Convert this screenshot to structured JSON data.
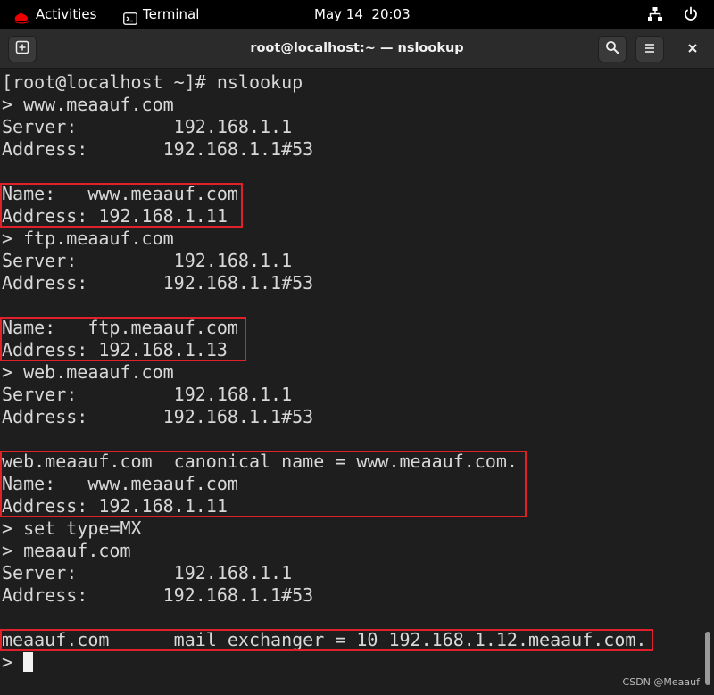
{
  "topbar": {
    "activities": "Activities",
    "app_name": "Terminal",
    "clock": "May 14  20:03"
  },
  "window": {
    "title": "root@localhost:~ — nslookup"
  },
  "terminal_lines": [
    "[root@localhost ~]# nslookup",
    "> www.meaauf.com",
    "Server:         192.168.1.1",
    "Address:       192.168.1.1#53",
    "",
    "Name:   www.meaauf.com",
    "Address: 192.168.1.11",
    "> ftp.meaauf.com",
    "Server:         192.168.1.1",
    "Address:       192.168.1.1#53",
    "",
    "Name:   ftp.meaauf.com",
    "Address: 192.168.1.13",
    "> web.meaauf.com",
    "Server:         192.168.1.1",
    "Address:       192.168.1.1#53",
    "",
    "web.meaauf.com  canonical name = www.meaauf.com.",
    "Name:   www.meaauf.com",
    "Address: 192.168.1.11",
    "> set type=MX",
    "> meaauf.com",
    "Server:         192.168.1.1",
    "Address:       192.168.1.1#53",
    "",
    "meaauf.com      mail exchanger = 10 192.168.1.12.meaauf.com.",
    "> "
  ],
  "watermark": "CSDN @Meaauf",
  "colors": {
    "terminal_bg": "#1e1e1e",
    "terminal_fg": "#d8d8d8",
    "highlight_box": "#e0202a",
    "redhat_red": "#ee0000"
  }
}
